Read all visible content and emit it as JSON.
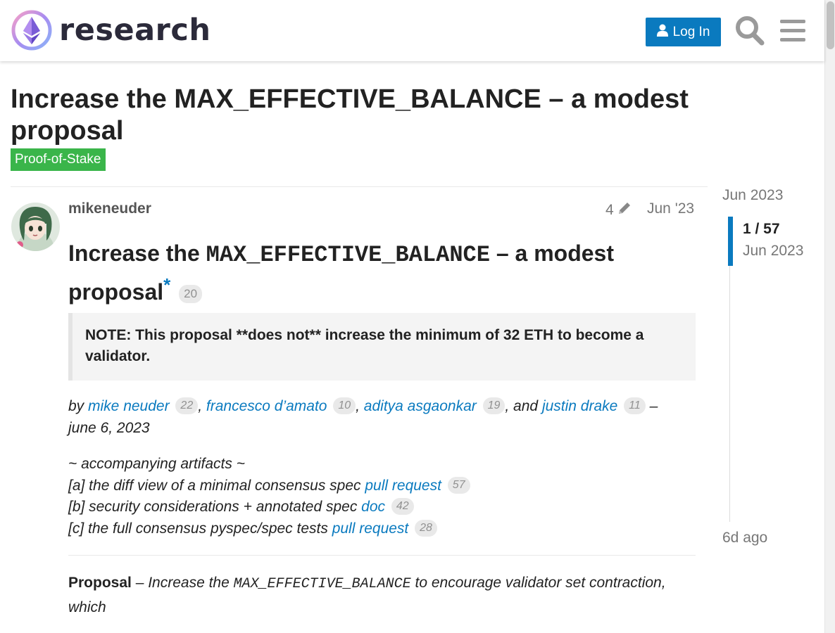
{
  "header": {
    "logo_text": "research",
    "login_label": "Log In",
    "icons": [
      "ethereum-logo",
      "user-icon",
      "search-icon",
      "hamburger-menu-icon"
    ]
  },
  "topic": {
    "title": "Increase the MAX_EFFECTIVE_BALANCE – a modest proposal",
    "category": "Proof-of-Stake",
    "category_color": "#3ab54a"
  },
  "post": {
    "username": "mikeneuder",
    "edit_count": "4",
    "date": "Jun '23",
    "heading_pre": "Increase the ",
    "heading_code": "MAX_EFFECTIVE_BALANCE",
    "heading_post": " – a modest proposal",
    "heading_star": "*",
    "heading_clicks": "20",
    "note": "NOTE: This proposal **does not** increase the minimum of 32 ETH to become a validator.",
    "authors": {
      "by": "by ",
      "list": [
        {
          "name": "mike neuder",
          "clicks": "22"
        },
        {
          "name": "francesco d’amato",
          "clicks": "10"
        },
        {
          "name": "aditya asgaonkar",
          "clicks": "19"
        },
        {
          "name": "justin drake",
          "clicks": "11"
        }
      ],
      "sep": ", ",
      "and": ", and ",
      "dash": " –",
      "date": "june 6, 2023"
    },
    "artifacts": {
      "heading": "~ accompanying artifacts ~",
      "items": [
        {
          "prefix": "[a] the diff view of a minimal consensus spec ",
          "link": "pull request",
          "clicks": "57"
        },
        {
          "prefix": "[b] security considerations + annotated spec ",
          "link": "doc",
          "clicks": "42"
        },
        {
          "prefix": "[c] the full consensus pyspec/spec tests ",
          "link": "pull request",
          "clicks": "28"
        }
      ]
    },
    "proposal": {
      "label": "Proposal",
      "dash": " – ",
      "text_pre": "Increase the ",
      "code": "MAX_EFFECTIVE_BALANCE",
      "text_post": " to encourage validator set contraction, which"
    }
  },
  "timeline": {
    "top": "Jun 2023",
    "position": "1 / 57",
    "position_date": "Jun 2023",
    "bottom": "6d ago"
  },
  "colors": {
    "link": "#0a7abf",
    "button": "#0a7abf",
    "badge": "#3ab54a"
  }
}
